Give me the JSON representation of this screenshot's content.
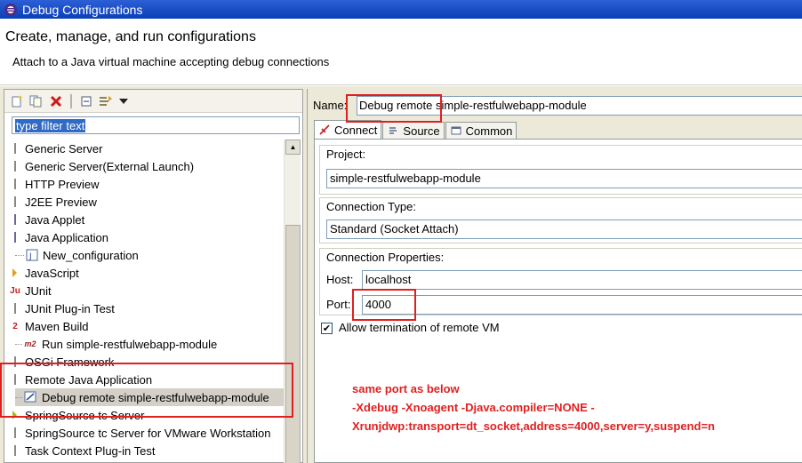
{
  "window": {
    "title": "Debug Configurations"
  },
  "header": {
    "title": "Create, manage, and run configurations",
    "subtitle": "Attach to a Java virtual machine accepting debug connections"
  },
  "toolbar": {
    "buttons": [
      "new-config-icon",
      "duplicate-icon",
      "delete-icon",
      "collapse-all-icon",
      "filter-icon",
      "view-menu-icon"
    ]
  },
  "filter": {
    "placeholder": "type filter text",
    "value": "type filter text"
  },
  "tree": {
    "items": [
      {
        "label": "Generic Server",
        "indent": 0
      },
      {
        "label": "Generic Server(External Launch)",
        "indent": 0
      },
      {
        "label": "HTTP Preview",
        "indent": 0
      },
      {
        "label": "J2EE Preview",
        "indent": 0
      },
      {
        "label": "Java Applet",
        "indent": 0
      },
      {
        "label": "Java Application",
        "indent": 0
      },
      {
        "label": "New_configuration",
        "indent": 1
      },
      {
        "label": "JavaScript",
        "indent": 0
      },
      {
        "label": "JUnit",
        "indent": 0
      },
      {
        "label": "JUnit Plug-in Test",
        "indent": 0
      },
      {
        "label": "Maven Build",
        "indent": 0
      },
      {
        "label": "Run simple-restfulwebapp-module",
        "indent": 1
      },
      {
        "label": "OSGi Framework",
        "indent": 0
      },
      {
        "label": "Remote Java Application",
        "indent": 0
      },
      {
        "label": "Debug remote simple-restfulwebapp-module",
        "indent": 1,
        "selected": true
      },
      {
        "label": "SpringSource tc Server",
        "indent": 0
      },
      {
        "label": "SpringSource tc Server for VMware Workstation",
        "indent": 0
      },
      {
        "label": "Task Context Plug-in Test",
        "indent": 0
      }
    ]
  },
  "config": {
    "name_label": "Name:",
    "name_value": "Debug remote simple-restfulwebapp-module",
    "tabs": [
      {
        "label": "Connect",
        "active": true,
        "icon": "connect-icon"
      },
      {
        "label": "Source",
        "active": false,
        "icon": "source-icon"
      },
      {
        "label": "Common",
        "active": false,
        "icon": "common-icon"
      }
    ],
    "project_label": "Project:",
    "project_value": "simple-restfulwebapp-module",
    "connection_type_label": "Connection Type:",
    "connection_type_value": "Standard (Socket Attach)",
    "connection_props_label": "Connection Properties:",
    "host_label": "Host:",
    "host_value": "localhost",
    "port_label": "Port:",
    "port_value": "4000",
    "allow_termination_label": "Allow termination of remote VM",
    "allow_termination_checked": true
  },
  "annotation": {
    "line1": "same port as below",
    "line2": "-Xdebug -Xnoagent -Djava.compiler=NONE -",
    "line3": "Xrunjdwp:transport=dt_socket,address=4000,server=y,suspend=n",
    "color": "#e02020"
  }
}
